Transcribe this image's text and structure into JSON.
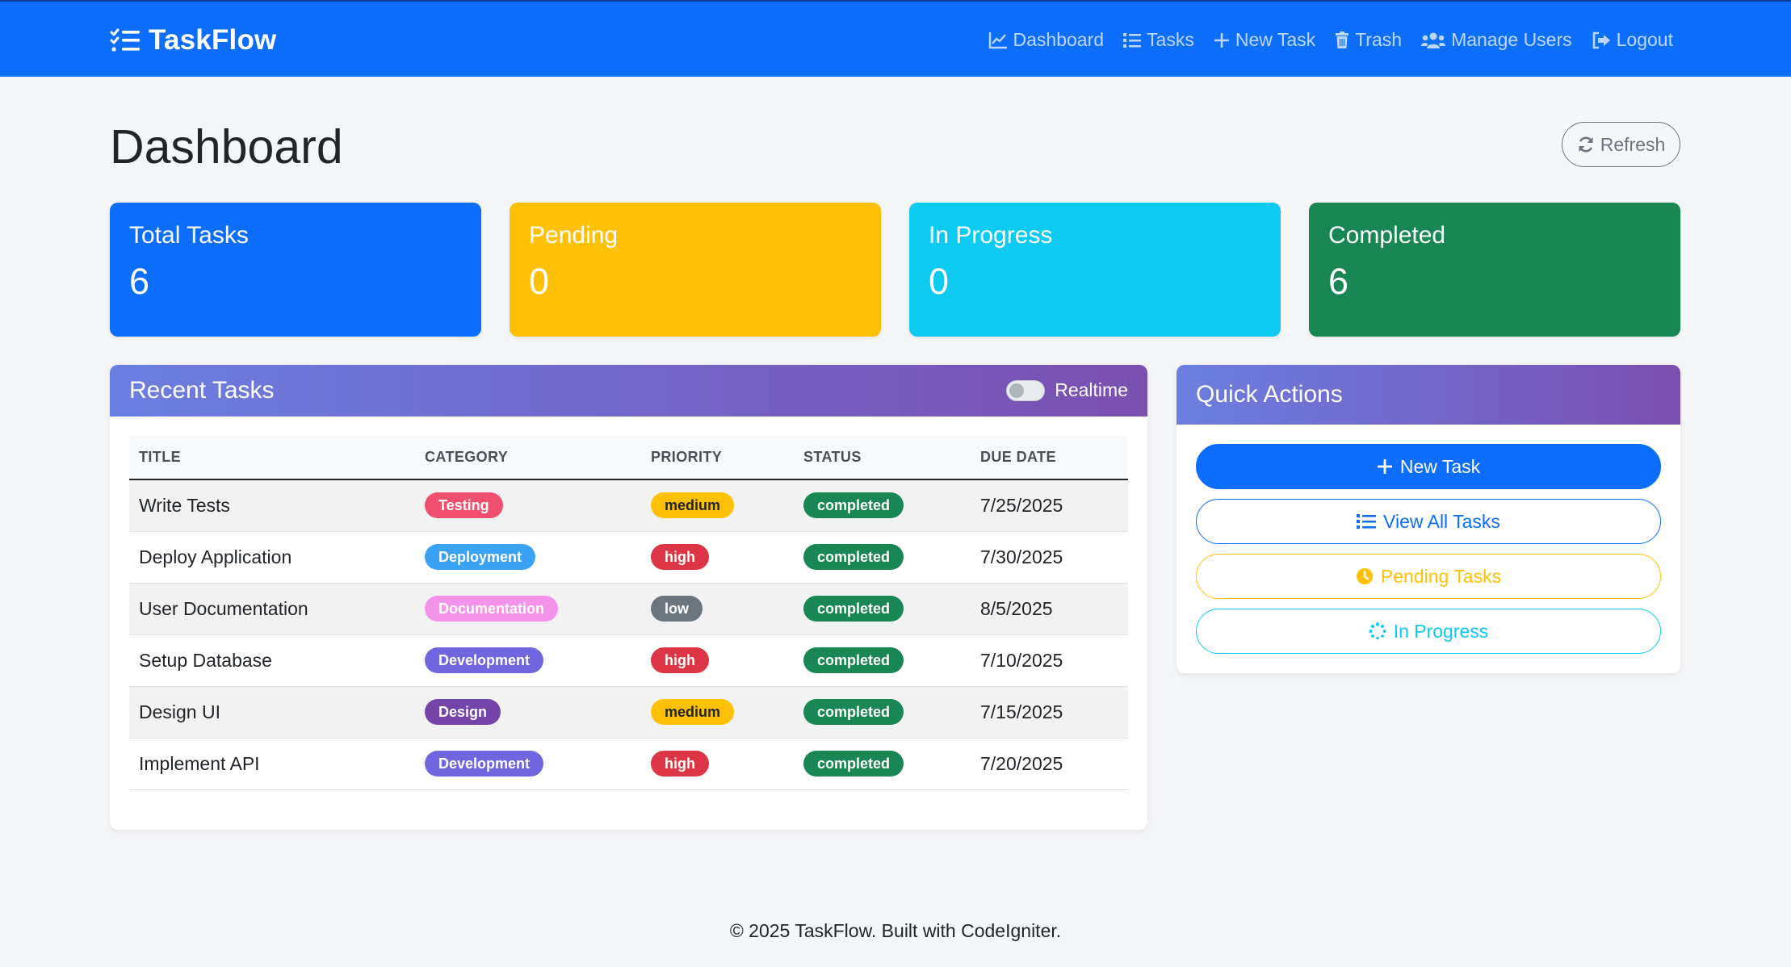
{
  "brand": {
    "name": "TaskFlow",
    "icon": "checklist-icon"
  },
  "nav": [
    {
      "label": "Dashboard",
      "icon": "chart-line-icon"
    },
    {
      "label": "Tasks",
      "icon": "list-icon"
    },
    {
      "label": "New Task",
      "icon": "plus-icon"
    },
    {
      "label": "Trash",
      "icon": "trash-icon"
    },
    {
      "label": "Manage Users",
      "icon": "users-icon"
    },
    {
      "label": "Logout",
      "icon": "logout-icon"
    }
  ],
  "page": {
    "title": "Dashboard",
    "refresh_label": "Refresh"
  },
  "stats": {
    "total": {
      "label": "Total Tasks",
      "value": "6"
    },
    "pending": {
      "label": "Pending",
      "value": "0"
    },
    "in_progress": {
      "label": "In Progress",
      "value": "0"
    },
    "completed": {
      "label": "Completed",
      "value": "6"
    }
  },
  "recent": {
    "title": "Recent Tasks",
    "realtime_label": "Realtime",
    "realtime_on": false,
    "columns": [
      "TITLE",
      "CATEGORY",
      "PRIORITY",
      "STATUS",
      "DUE DATE"
    ],
    "rows": [
      {
        "title": "Write Tests",
        "category": "Testing",
        "category_color": "#f0506e",
        "priority": "medium",
        "status": "completed",
        "due": "7/25/2025"
      },
      {
        "title": "Deploy Application",
        "category": "Deployment",
        "category_color": "#3aa3f5",
        "priority": "high",
        "status": "completed",
        "due": "7/30/2025"
      },
      {
        "title": "User Documentation",
        "category": "Documentation",
        "category_color": "#f593ea",
        "priority": "low",
        "status": "completed",
        "due": "8/5/2025"
      },
      {
        "title": "Setup Database",
        "category": "Development",
        "category_color": "#7266e0",
        "priority": "high",
        "status": "completed",
        "due": "7/10/2025"
      },
      {
        "title": "Design UI",
        "category": "Design",
        "category_color": "#7544a8",
        "priority": "medium",
        "status": "completed",
        "due": "7/15/2025"
      },
      {
        "title": "Implement API",
        "category": "Development",
        "category_color": "#7266e0",
        "priority": "high",
        "status": "completed",
        "due": "7/20/2025"
      }
    ]
  },
  "priority_colors": {
    "high": "#dc3545",
    "medium": "#ffc107",
    "low": "#6c757d"
  },
  "priority_text_colors": {
    "high": "#ffffff",
    "medium": "#212529",
    "low": "#ffffff"
  },
  "status_colors": {
    "completed": "#198754"
  },
  "quick_actions": {
    "title": "Quick Actions",
    "new_task": "New Task",
    "view_all": "View All Tasks",
    "pending": "Pending Tasks",
    "in_progress": "In Progress"
  },
  "footer": {
    "text": "© 2025 TaskFlow. Built with CodeIgniter."
  },
  "colors": {
    "primary": "#0d6efd",
    "warning": "#ffc107",
    "info": "#0dcaf0",
    "success": "#198754"
  }
}
